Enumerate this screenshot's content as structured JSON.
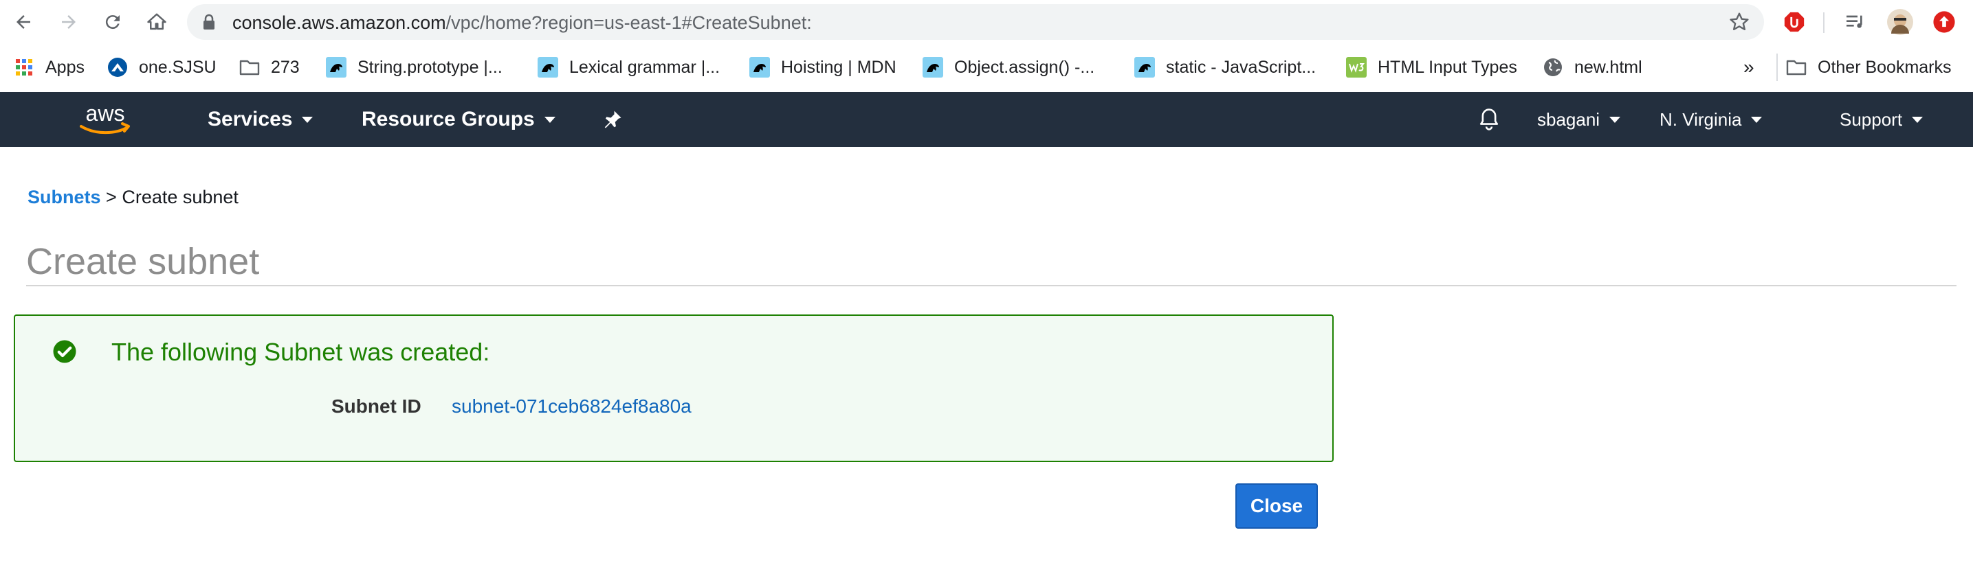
{
  "browser": {
    "url_host": "console.aws.amazon.com",
    "url_path": "/vpc/home?region=us-east-1#CreateSubnet:"
  },
  "bookmarks": {
    "items": [
      {
        "label": "Apps",
        "icon": "apps-grid-icon"
      },
      {
        "label": "one.SJSU",
        "icon": "sjsu-logo-icon"
      },
      {
        "label": "273",
        "icon": "folder-icon"
      },
      {
        "label": "String.prototype |...",
        "icon": "mdn-dino-icon"
      },
      {
        "label": "Lexical grammar |...",
        "icon": "mdn-dino-icon"
      },
      {
        "label": "Hoisting | MDN",
        "icon": "mdn-dino-icon"
      },
      {
        "label": "Object.assign() -...",
        "icon": "mdn-dino-icon"
      },
      {
        "label": "static - JavaScript...",
        "icon": "mdn-dino-icon"
      },
      {
        "label": "HTML Input Types",
        "icon": "w3schools-icon"
      },
      {
        "label": "new.html",
        "icon": "globe-icon"
      }
    ],
    "overflow": "»",
    "other": "Other Bookmarks"
  },
  "aws_nav": {
    "services": "Services",
    "resource_groups": "Resource Groups",
    "user": "sbagani",
    "region": "N. Virginia",
    "support": "Support"
  },
  "breadcrumb": {
    "parent": "Subnets",
    "separator": ">",
    "current": "Create subnet"
  },
  "page": {
    "title": "Create subnet"
  },
  "success": {
    "message": "The following Subnet was created:",
    "id_label": "Subnet ID",
    "id_value": "subnet-071ceb6824ef8a80a"
  },
  "actions": {
    "close": "Close"
  },
  "colors": {
    "aws_nav_bg": "#232f3e",
    "aws_orange": "#ff9900",
    "link_blue": "#1d7ed8",
    "success_green": "#1d8102",
    "primary_button": "#1f72d6"
  }
}
